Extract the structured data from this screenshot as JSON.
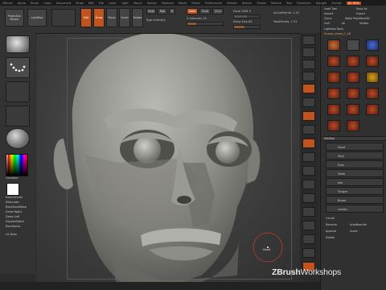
{
  "menubar": {
    "title": "ZBrush",
    "items": [
      "Alpha",
      "Brush",
      "Color",
      "Document",
      "Draw",
      "Edit",
      "File",
      "Layer",
      "Light",
      "Macro",
      "Marker",
      "Material",
      "Movie",
      "Picker",
      "Preferences",
      "Render",
      "Stencil",
      "Stroke",
      "Texture",
      "Tool",
      "Transform",
      "Zplugin",
      "Zscript"
    ],
    "highlight": "AC 50%"
  },
  "left_shelf": {
    "projection_label": "Projection Master",
    "lightbox_label": "LightBox",
    "gradient_label": "Gradient",
    "switch_color_label": "SwitchColor",
    "menu_items": [
      "Alternate",
      "BackFaceMask",
      "Draw Right",
      "Draw Left",
      "DoubleSided",
      "Backfaces",
      "Lit Dots"
    ]
  },
  "toolbar": {
    "edit": "Edit",
    "draw": "Draw",
    "move": "Move",
    "scale": "Scale",
    "rotate": "Rotate",
    "mrgb": "Mrgb",
    "rgb": "Rgb",
    "m": "M",
    "zadd": "Zadd",
    "zsub": "Zsub",
    "zcut": "Zcut",
    "rgb_intensity": "Rgb Intensity",
    "z_intensity": "Z Intensity 25",
    "focal_shift": "Focal Shift 0",
    "draw_size": "Draw Size 64",
    "active_points": "ActivePoints: 1.51",
    "total_points": "TotalPoints: 1.51",
    "z_intensity_value": 0.25,
    "draw_size_value": 0.4
  },
  "right_panel": {
    "load_tool": "Load Tool",
    "save_as": "Save As",
    "import": "Import",
    "export": "Export",
    "clone": "Clone",
    "make_polymesh": "Make PolyMesh3D",
    "goz": "GoZ",
    "all": "All",
    "visible": "Visible",
    "lightbox_tools": "Lightbox Tools",
    "tool_name": "Human_Head_C_48",
    "subtool_header": "SubTool",
    "subtool_names": [
      "Head",
      "Skull",
      "Eyes",
      "Teeth",
      "Jaw",
      "Tongue",
      "Brows",
      "Lashes"
    ],
    "list_all": "List All",
    "rename": "Rename",
    "auto_reorder": "AutoReorder",
    "append": "Append",
    "insert": "Insert",
    "delete": "Delete"
  },
  "viewport": {
    "cursor_label": "Head"
  },
  "watermark": {
    "brand": "ZBrush",
    "rest": "Workshops"
  },
  "colors": {
    "accent": "#c2531c",
    "background": "#2c2c2c",
    "swatch_main": "#ffffff"
  }
}
